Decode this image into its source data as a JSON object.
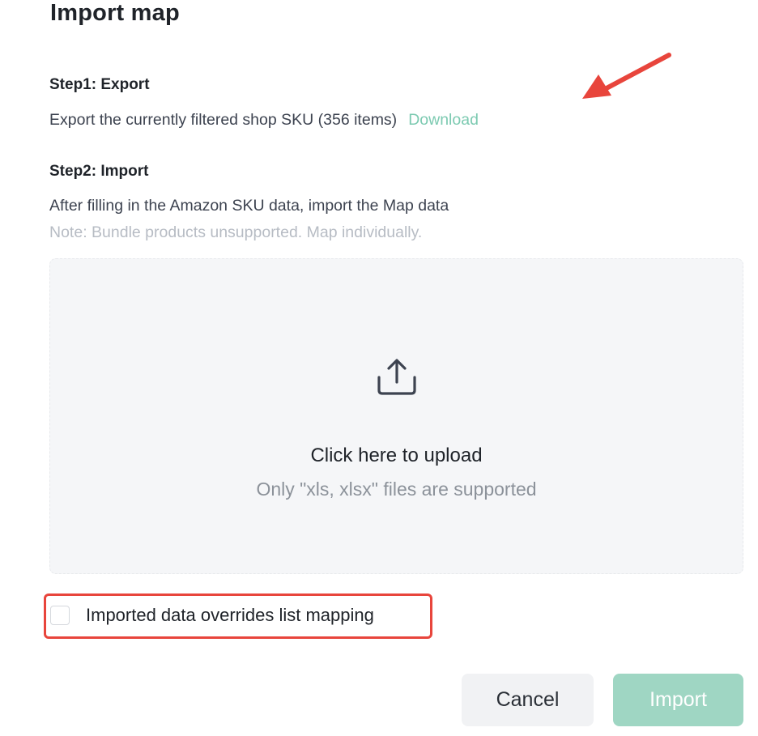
{
  "dialog": {
    "title": "Import map"
  },
  "step1": {
    "heading": "Step1: Export",
    "description": "Export the currently filtered shop SKU (356 items)",
    "download_label": "Download"
  },
  "step2": {
    "heading": "Step2: Import",
    "description": "After filling in the Amazon SKU data, import the Map data",
    "note": "Note: Bundle products unsupported. Map individually."
  },
  "upload": {
    "icon": "upload-icon",
    "title": "Click here to upload",
    "hint": "Only \"xls, xlsx\" files are supported"
  },
  "override_option": {
    "label": "Imported data overrides list mapping",
    "checked": false
  },
  "footer": {
    "cancel_label": "Cancel",
    "import_label": "Import"
  },
  "colors": {
    "accent": "#7ccab1",
    "primary_button_disabled": "#9fd6c3",
    "annotation_red": "#e8453c"
  }
}
